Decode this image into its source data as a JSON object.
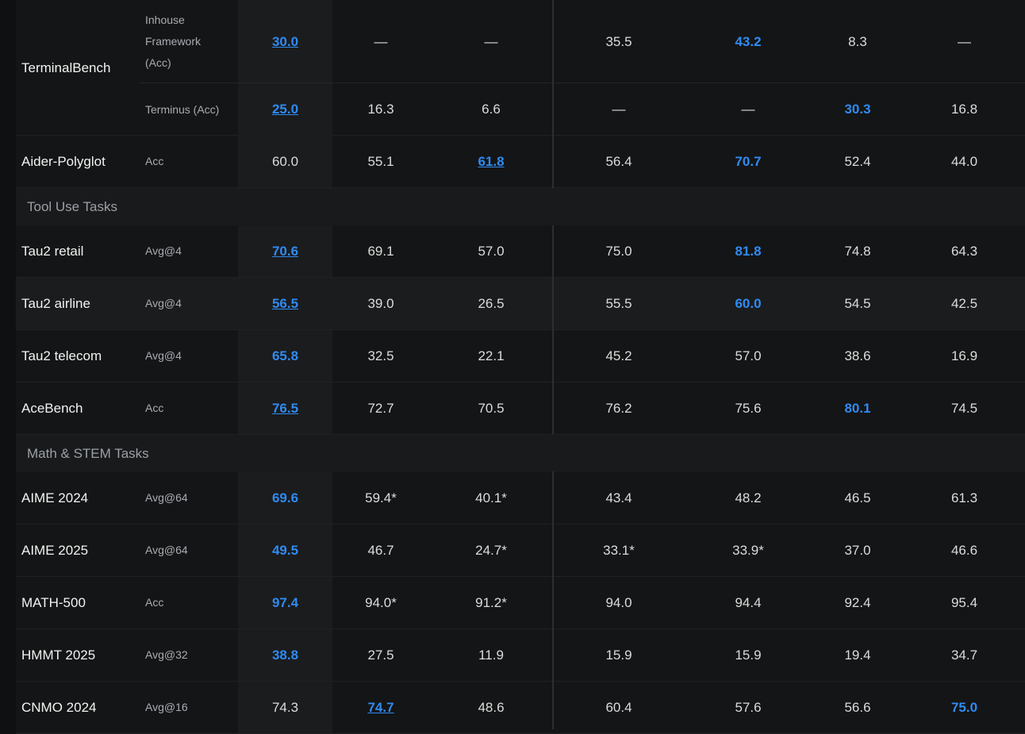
{
  "terminal_bench": {
    "benchmark": "TerminalBench",
    "rows": [
      {
        "metric_lines": [
          "Inhouse",
          "Framework",
          "(Acc)"
        ],
        "values": [
          "30.0",
          "—",
          "—",
          "35.5",
          "43.2",
          "8.3",
          "—"
        ],
        "styles": [
          "best-u",
          "",
          "",
          "",
          "best",
          "",
          ""
        ]
      },
      {
        "metric_lines": [
          "Terminus (Acc)"
        ],
        "values": [
          "25.0",
          "16.3",
          "6.6",
          "—",
          "—",
          "30.3",
          "16.8"
        ],
        "styles": [
          "best-u",
          "",
          "",
          "",
          "",
          "best",
          ""
        ]
      }
    ]
  },
  "pre_rows": [
    {
      "benchmark": "Aider-Polyglot",
      "metric": "Acc",
      "values": [
        "60.0",
        "55.1",
        "61.8",
        "56.4",
        "70.7",
        "52.4",
        "44.0"
      ],
      "styles": [
        "",
        "",
        "best-u",
        "",
        "best",
        "",
        ""
      ]
    }
  ],
  "sections": [
    {
      "label": "Tool Use Tasks",
      "rows": [
        {
          "benchmark": "Tau2 retail",
          "metric": "Avg@4",
          "values": [
            "70.6",
            "69.1",
            "57.0",
            "75.0",
            "81.8",
            "74.8",
            "64.3"
          ],
          "styles": [
            "best-u",
            "",
            "",
            "",
            "best",
            "",
            ""
          ]
        },
        {
          "benchmark": "Tau2 airline",
          "metric": "Avg@4",
          "values": [
            "56.5",
            "39.0",
            "26.5",
            "55.5",
            "60.0",
            "54.5",
            "42.5"
          ],
          "styles": [
            "best-u",
            "",
            "",
            "",
            "best",
            "",
            ""
          ]
        },
        {
          "benchmark": "Tau2 telecom",
          "metric": "Avg@4",
          "values": [
            "65.8",
            "32.5",
            "22.1",
            "45.2",
            "57.0",
            "38.6",
            "16.9"
          ],
          "styles": [
            "best",
            "",
            "",
            "",
            "",
            "",
            ""
          ]
        },
        {
          "benchmark": "AceBench",
          "metric": "Acc",
          "values": [
            "76.5",
            "72.7",
            "70.5",
            "76.2",
            "75.6",
            "80.1",
            "74.5"
          ],
          "styles": [
            "best-u",
            "",
            "",
            "",
            "",
            "best",
            ""
          ]
        }
      ]
    },
    {
      "label": "Math & STEM Tasks",
      "rows": [
        {
          "benchmark": "AIME 2024",
          "metric": "Avg@64",
          "values": [
            "69.6",
            "59.4*",
            "40.1*",
            "43.4",
            "48.2",
            "46.5",
            "61.3"
          ],
          "styles": [
            "best",
            "",
            "",
            "",
            "",
            "",
            ""
          ]
        },
        {
          "benchmark": "AIME 2025",
          "metric": "Avg@64",
          "values": [
            "49.5",
            "46.7",
            "24.7*",
            "33.1*",
            "33.9*",
            "37.0",
            "46.6"
          ],
          "styles": [
            "best",
            "",
            "",
            "",
            "",
            "",
            ""
          ]
        },
        {
          "benchmark": "MATH-500",
          "metric": "Acc",
          "values": [
            "97.4",
            "94.0*",
            "91.2*",
            "94.0",
            "94.4",
            "92.4",
            "95.4"
          ],
          "styles": [
            "best",
            "",
            "",
            "",
            "",
            "",
            ""
          ]
        },
        {
          "benchmark": "HMMT 2025",
          "metric": "Avg@32",
          "values": [
            "38.8",
            "27.5",
            "11.9",
            "15.9",
            "15.9",
            "19.4",
            "34.7"
          ],
          "styles": [
            "best",
            "",
            "",
            "",
            "",
            "",
            ""
          ]
        },
        {
          "benchmark": "CNMO 2024",
          "metric": "Avg@16",
          "values": [
            "74.3",
            "74.7",
            "48.6",
            "60.4",
            "57.6",
            "56.6",
            "75.0"
          ],
          "styles": [
            "",
            "best-u",
            "",
            "",
            "",
            "",
            "best"
          ]
        }
      ]
    }
  ],
  "colors": {
    "best": "#2f8bf2",
    "background": "#0f1011",
    "section": "#191a1c"
  }
}
